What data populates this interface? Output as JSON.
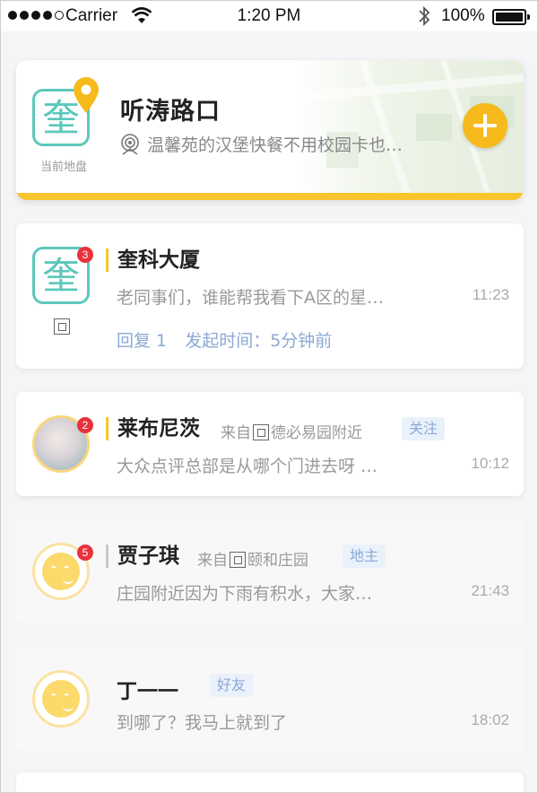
{
  "status_bar": {
    "carrier": "Carrier",
    "time": "1:20 PM",
    "battery": "100%"
  },
  "location_card": {
    "logo_glyph": "奎",
    "current_label": "当前地盘",
    "title": "听涛路口",
    "description": "温馨苑的汉堡快餐不用校园卡也…"
  },
  "threads": [
    {
      "title": "奎科大厦",
      "badge": "3",
      "logo_glyph": "奎",
      "preview": "老同事们，谁能帮我看下A区的星…",
      "time": "11:23",
      "reply_label": "回复 1",
      "start_label": "发起时间：5分钟前"
    },
    {
      "title": "莱布尼茨",
      "badge": "2",
      "from_prefix": "来自",
      "from_place": "德必易园附近",
      "tag": "关注",
      "preview": "大众点评总部是从哪个门进去呀 …",
      "time": "10:12"
    },
    {
      "title": "贾子琪",
      "badge": "5",
      "from_prefix": "来自",
      "from_place": "颐和庄园",
      "tag": "地主",
      "preview": "庄园附近因为下雨有积水，大家…",
      "time": "21:43"
    },
    {
      "title": "丁一一",
      "tag": "好友",
      "preview": "到哪了？我马上就到了",
      "time": "18:02"
    }
  ],
  "colors": {
    "accent_yellow": "#f9c52e",
    "teal": "#5cc8bb",
    "tag_blue": "#8ba9d3",
    "badge_red": "#e8323c"
  }
}
